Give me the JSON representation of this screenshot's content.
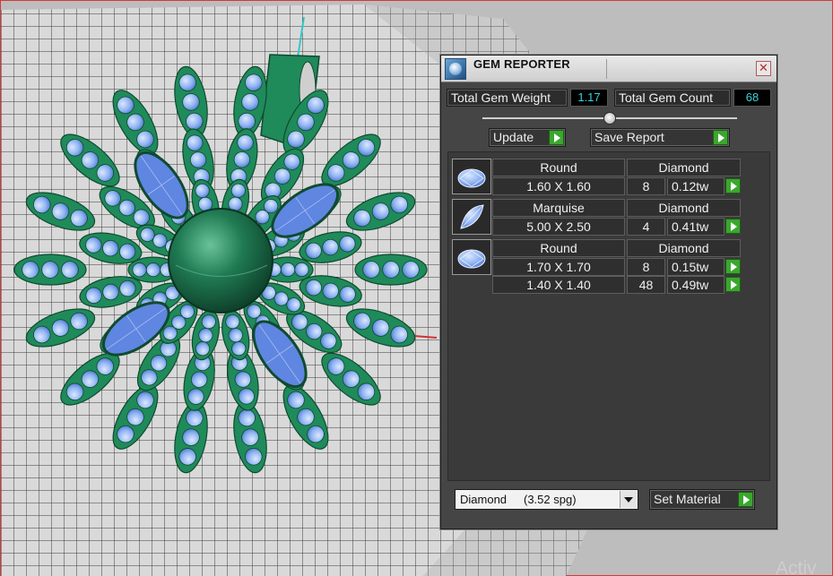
{
  "window": {
    "title": "GEM REPORTER",
    "close_glyph": "✕",
    "icon": "gem-reporter-app-icon"
  },
  "stats": {
    "total_weight_label": "Total Gem Weight",
    "total_weight_value": "1.17",
    "total_count_label": "Total Gem Count",
    "total_count_value": "68",
    "value_color": "#39d3d6"
  },
  "actions": {
    "update_label": "Update",
    "save_report_label": "Save Report"
  },
  "gem_groups": [
    {
      "shape": "Round",
      "material": "Diamond",
      "rows": [
        {
          "size": "1.60 X 1.60",
          "count": "8",
          "weight": "0.12tw"
        }
      ]
    },
    {
      "shape": "Marquise",
      "material": "Diamond",
      "rows": [
        {
          "size": "5.00 X 2.50",
          "count": "4",
          "weight": "0.41tw"
        }
      ]
    },
    {
      "shape": "Round",
      "material": "Diamond",
      "rows": [
        {
          "size": "1.70 X 1.70",
          "count": "8",
          "weight": "0.15tw"
        },
        {
          "size": "1.40 X 1.40",
          "count": "48",
          "weight": "0.49tw"
        }
      ]
    }
  ],
  "material": {
    "selected": "Diamond",
    "spg": "(3.52 spg)",
    "set_label": "Set Material"
  },
  "colors": {
    "viewport_bg": "#bdbdbd",
    "pendant_green": "#1f8a5a",
    "gem_blue": "#6f9bea",
    "accent_green": "#3aa72d"
  },
  "watermark": "Activ"
}
